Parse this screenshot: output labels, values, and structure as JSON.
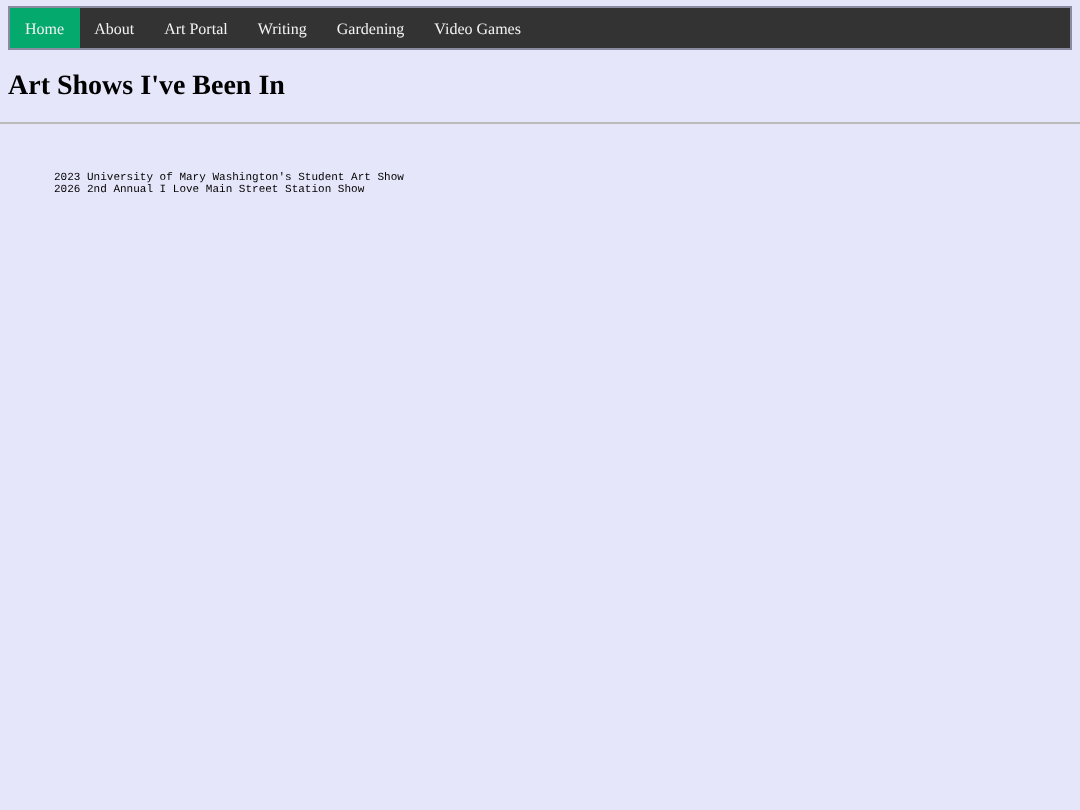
{
  "nav": [
    {
      "label": "Home",
      "selected": true
    },
    {
      "label": "About",
      "selected": false
    },
    {
      "label": "Art Portal",
      "selected": false
    },
    {
      "label": "Writing",
      "selected": false
    },
    {
      "label": "Gardening",
      "selected": false
    },
    {
      "label": "Video Games",
      "selected": false
    }
  ],
  "heading": "Art Shows I've Been In",
  "shows": [
    "2023 University of Mary Washington's Student Art Show",
    "2026 2nd Annual I Love Main Street Station Show"
  ]
}
